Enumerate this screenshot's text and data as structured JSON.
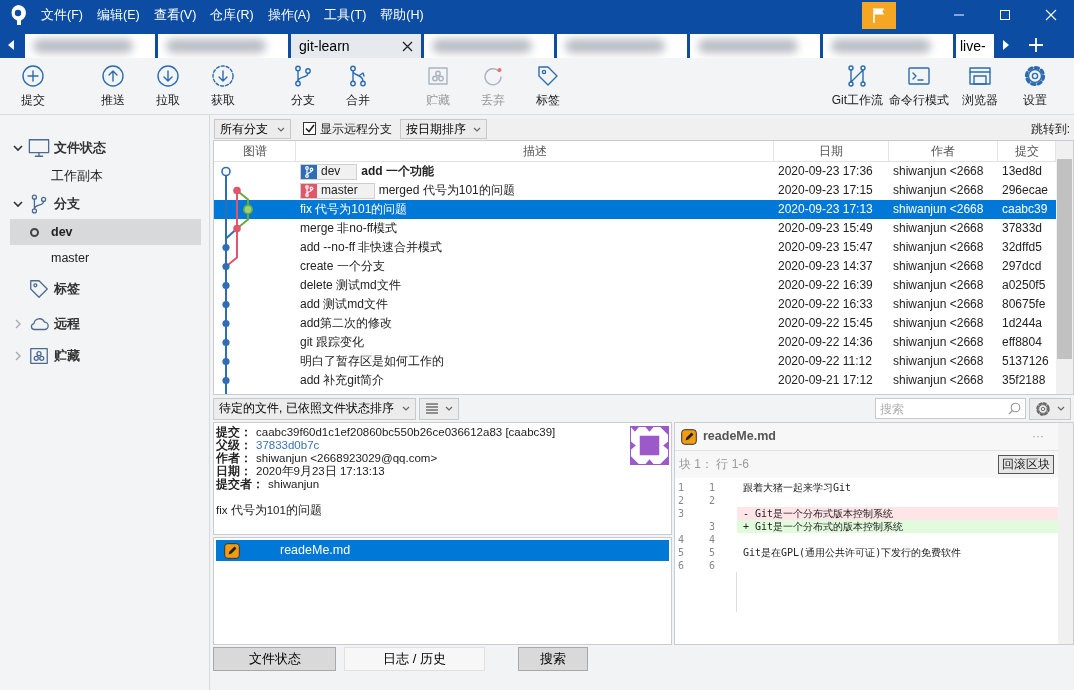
{
  "menu": [
    "文件(F)",
    "编辑(E)",
    "查看(V)",
    "仓库(R)",
    "操作(A)",
    "工具(T)",
    "帮助(H)"
  ],
  "tabs": [
    {
      "kind": "blurred",
      "selected": false
    },
    {
      "kind": "blurred",
      "selected": false
    },
    {
      "kind": "named",
      "label": "git-learn",
      "selected": true
    },
    {
      "kind": "blurred",
      "selected": false
    },
    {
      "kind": "blurred",
      "selected": false
    },
    {
      "kind": "blurred",
      "selected": false
    },
    {
      "kind": "blurred",
      "selected": false
    },
    {
      "kind": "named",
      "label": "live-",
      "selected": false
    }
  ],
  "toolbar": {
    "left_groups": [
      [
        {
          "label": "提交",
          "kind": "plus",
          "disabled": false
        }
      ],
      [
        {
          "label": "推送",
          "kind": "up",
          "disabled": false
        },
        {
          "label": "拉取",
          "kind": "down",
          "disabled": false
        },
        {
          "label": "获取",
          "kind": "fetch",
          "disabled": false
        }
      ],
      [
        {
          "label": "分支",
          "kind": "branch",
          "disabled": false
        },
        {
          "label": "合并",
          "kind": "merge",
          "disabled": false
        }
      ],
      [
        {
          "label": "贮藏",
          "kind": "stash",
          "disabled": true
        },
        {
          "label": "丢弃",
          "kind": "discard",
          "disabled": true
        },
        {
          "label": "标签",
          "kind": "tag",
          "disabled": false
        }
      ]
    ],
    "right": [
      {
        "label": "Git工作流",
        "kind": "flow",
        "disabled": false
      },
      {
        "label": "命令行模式",
        "kind": "terminal",
        "disabled": false
      },
      {
        "label": "浏览器",
        "kind": "browser",
        "disabled": false
      },
      {
        "label": "设置",
        "kind": "settings",
        "disabled": false
      }
    ]
  },
  "sidebar": [
    {
      "label": "文件状态",
      "kind": "monitor",
      "expanded": true,
      "children": [
        {
          "label": "工作副本",
          "selected": false,
          "current": false
        }
      ]
    },
    {
      "label": "分支",
      "kind": "branch",
      "expanded": true,
      "children": [
        {
          "label": "dev",
          "selected": true,
          "current": true
        },
        {
          "label": "master",
          "selected": false,
          "current": false
        }
      ]
    },
    {
      "label": "标签",
      "kind": "tag"
    },
    {
      "label": "远程",
      "kind": "cloud",
      "expanded": false
    },
    {
      "label": "贮藏",
      "kind": "stash",
      "expanded": false
    }
  ],
  "filter_bar": {
    "branch_filter": "所有分支",
    "show_remote": {
      "label": "显示远程分支",
      "checked": true
    },
    "sort": "按日期排序",
    "jump_label": "跳转到:"
  },
  "commit_table": {
    "columns": [
      "图谱",
      "描述",
      "日期",
      "作者",
      "提交"
    ],
    "rows": [
      {
        "description": "add 一个功能",
        "head": true,
        "refs": [
          {
            "name": "dev",
            "color": "#2f6db5"
          }
        ],
        "date": "2020-09-23 17:36",
        "author": "shiwanjun <2668",
        "hash": "13ed8d",
        "selected": false
      },
      {
        "description": "merged 代号为101的问题",
        "head": false,
        "refs": [
          {
            "name": "master",
            "color": "#e0566b"
          }
        ],
        "date": "2020-09-23 17:15",
        "author": "shiwanjun <2668",
        "hash": "296ecae",
        "selected": false
      },
      {
        "description": "fix 代号为101的问题",
        "head": false,
        "date": "2020-09-23 17:13",
        "author": "shiwanjun <2668",
        "hash": "caabc39",
        "selected": true
      },
      {
        "description": "merge 非no-ff模式",
        "head": false,
        "date": "2020-09-23 15:49",
        "author": "shiwanjun <2668",
        "hash": "37833d",
        "selected": false
      },
      {
        "description": "add --no-ff 非快速合并模式",
        "head": false,
        "date": "2020-09-23 15:47",
        "author": "shiwanjun <2668",
        "hash": "32dffd5",
        "selected": false
      },
      {
        "description": "create 一个分支",
        "head": false,
        "date": "2020-09-23 14:37",
        "author": "shiwanjun <2668",
        "hash": "297dcd",
        "selected": false
      },
      {
        "description": "delete 测试md文件",
        "head": false,
        "date": "2020-09-22 16:39",
        "author": "shiwanjun <2668",
        "hash": "a0250f5",
        "selected": false
      },
      {
        "description": "add 测试md文件",
        "head": false,
        "date": "2020-09-22 16:33",
        "author": "shiwanjun <2668",
        "hash": "80675fe",
        "selected": false
      },
      {
        "description": "add第二次的修改",
        "head": false,
        "date": "2020-09-22 15:45",
        "author": "shiwanjun <2668",
        "hash": "1d244a",
        "selected": false
      },
      {
        "description": "git 跟踪变化",
        "head": false,
        "date": "2020-09-22 14:36",
        "author": "shiwanjun <2668",
        "hash": "eff8804",
        "selected": false
      },
      {
        "description": "明白了暂存区是如何工作的",
        "head": false,
        "date": "2020-09-22 11:12",
        "author": "shiwanjun <2668",
        "hash": "5137126",
        "selected": false
      },
      {
        "description": "add 补充git简介",
        "head": false,
        "date": "2020-09-21 17:12",
        "author": "shiwanjun <2668",
        "hash": "35f2188",
        "selected": false
      }
    ]
  },
  "details_toolbar": {
    "file_sort": "待定的文件, 已依照文件状态排序",
    "search_placeholder": "搜索"
  },
  "commit_details": {
    "fields": [
      {
        "label": "提交：",
        "value": "caabc39f60d1c1ef20860bc550b26ce036612a83 [caabc39]",
        "kind": "text"
      },
      {
        "label": "父级：",
        "value": "37833d0b7c",
        "kind": "link"
      },
      {
        "label": "作者：",
        "value": "shiwanjun <2668923029@qq.com>",
        "kind": "text"
      },
      {
        "label": "日期：",
        "value": "2020年9月23日 17:13:13",
        "kind": "text"
      },
      {
        "label": "提交者：",
        "value": "shiwanjun",
        "kind": "text"
      }
    ],
    "message": "fix 代号为101的问题"
  },
  "files": [
    {
      "name": "readeMe.md",
      "kind": "modified",
      "selected": true
    }
  ],
  "diff": {
    "file": "readeMe.md",
    "kind": "modified",
    "menu_glyph": "···",
    "hunk_title": "块 1： 行 1-6",
    "hunk_button": "回滚区块",
    "lines": [
      {
        "kind": "context",
        "old": "1",
        "new": "1",
        "text": "跟着大猪一起来学习Git"
      },
      {
        "kind": "context",
        "old": "2",
        "new": "2"
      },
      {
        "kind": "removed",
        "old": "3",
        "text": "- Git是一个分布式版本控制系统"
      },
      {
        "kind": "added",
        "new": "3",
        "text": "+ Git是一个分布式的版本控制系统"
      },
      {
        "kind": "context",
        "old": "4",
        "new": "4"
      },
      {
        "kind": "context",
        "old": "5",
        "new": "5",
        "text": "Git是在GPL(通用公共许可证)下发行的免费软件"
      },
      {
        "kind": "context",
        "old": "6",
        "new": "6"
      }
    ]
  },
  "bottom_tabs": [
    {
      "label": "文件状态",
      "selected": false
    },
    {
      "label": "日志 / 历史",
      "selected": true
    },
    {
      "label": "搜索",
      "selected": false
    }
  ]
}
